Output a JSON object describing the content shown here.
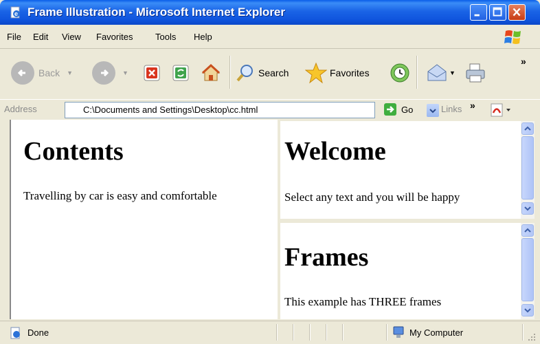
{
  "window": {
    "title": "Frame Illustration - Microsoft Internet Explorer"
  },
  "menu": {
    "items": [
      "File",
      "Edit",
      "View",
      "Favorites",
      "Tools",
      "Help"
    ]
  },
  "toolbar": {
    "back_label": "Back",
    "search_label": "Search",
    "favorites_label": "Favorites",
    "more_chevron": "»"
  },
  "address": {
    "label": "Address",
    "value": "C:\\Documents and Settings\\Desktop\\cc.html",
    "go_label": "Go",
    "links_label": "Links",
    "links_chevron": "»"
  },
  "frames": {
    "left": {
      "heading": "Contents",
      "text": "Travelling by car is easy and comfortable"
    },
    "top_right": {
      "heading": "Welcome",
      "text": "Select any text and you will be happy"
    },
    "bottom_right": {
      "heading": "Frames",
      "text": "This example has THREE frames"
    }
  },
  "status": {
    "text": "Done",
    "zone": "My Computer"
  },
  "colors": {
    "titlebar": "#0f54dd",
    "close": "#c73b13",
    "chrome": "#ece9d8"
  }
}
